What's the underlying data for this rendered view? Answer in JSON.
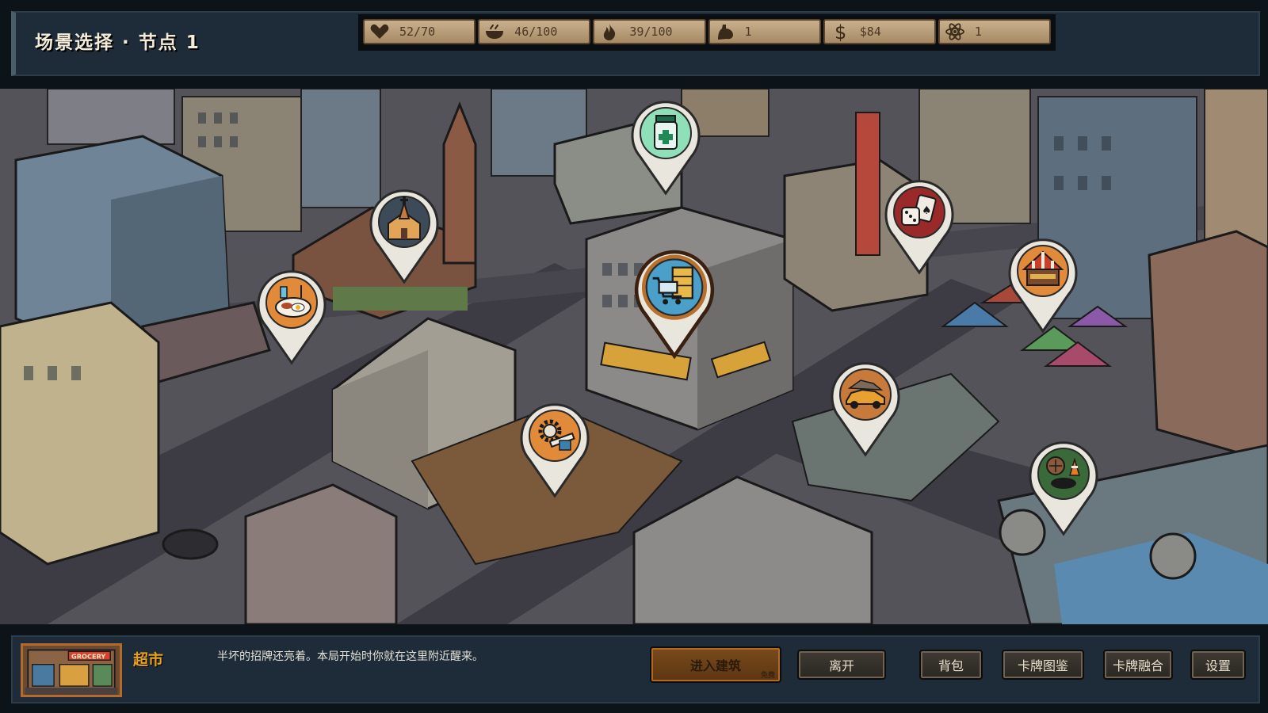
{
  "header": {
    "title": "场景选择 · 节点 1"
  },
  "stats": [
    {
      "icon": "heart-icon",
      "value": "52/70"
    },
    {
      "icon": "food-bowl-icon",
      "value": "46/100"
    },
    {
      "icon": "flame-icon",
      "value": "39/100"
    },
    {
      "icon": "muscle-arm-icon",
      "value": "1"
    },
    {
      "icon": "dollar-icon",
      "value": "$84"
    },
    {
      "icon": "atom-icon",
      "value": "1"
    }
  ],
  "map": {
    "pins": [
      {
        "name": "pharmacy-pin",
        "icon": "medicine-bottle-icon",
        "color": "#8fe0b8"
      },
      {
        "name": "church-pin",
        "icon": "church-icon",
        "color": "#3d4b58"
      },
      {
        "name": "casino-pin",
        "icon": "dice-cards-icon",
        "color": "#9a2a2a"
      },
      {
        "name": "diner-pin",
        "icon": "food-plate-icon",
        "color": "#e08a3a"
      },
      {
        "name": "supermarket-pin",
        "icon": "shopping-cart-icon",
        "color": "#4aa0c8",
        "selected": true
      },
      {
        "name": "market-pin",
        "icon": "tent-icon",
        "color": "#e08a3a"
      },
      {
        "name": "junkyard-pin",
        "icon": "wrecked-car-icon",
        "color": "#c87a3a"
      },
      {
        "name": "workshop-pin",
        "icon": "gear-wrench-icon",
        "color": "#e08a3a"
      },
      {
        "name": "sewer-pin",
        "icon": "manhole-icon",
        "color": "#3a6a3a"
      }
    ]
  },
  "scene": {
    "name": "超市",
    "description": "半坏的招牌还亮着。本局开始时你就在这里附近醒来。",
    "thumb_sign": "GROCERY"
  },
  "buttons": {
    "enter": "进入建筑",
    "enter_sub": "免费",
    "leave": "离开",
    "backpack": "背包",
    "card_codex": "卡牌图鉴",
    "card_fusion": "卡牌融合",
    "settings": "设置"
  },
  "colors": {
    "accent": "#e8a21c",
    "panel": "#1d2c38",
    "stat_bg": "#b89c76"
  }
}
